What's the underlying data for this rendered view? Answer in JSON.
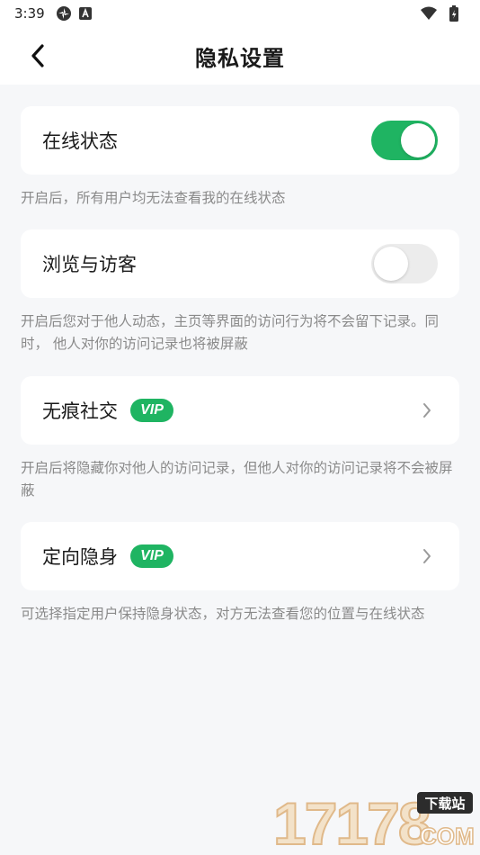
{
  "status_bar": {
    "time": "3:39",
    "icons": [
      "settings-flower-icon",
      "a-badge-icon",
      "wifi-icon",
      "battery-icon"
    ]
  },
  "header": {
    "title": "隐私设置",
    "back_icon": "chevron-left-icon"
  },
  "settings": [
    {
      "label": "在线状态",
      "control": "toggle",
      "enabled": true,
      "description": "开启后，所有用户均无法查看我的在线状态"
    },
    {
      "label": "浏览与访客",
      "control": "toggle",
      "enabled": false,
      "description": "开启后您对于他人动态，主页等界面的访问行为将不会留下记录。同时， 他人对你的访问记录也将被屏蔽"
    },
    {
      "label": "无痕社交",
      "badge": "VIP",
      "control": "chevron",
      "description": "开启后将隐藏你对他人的访问记录，但他人对你的访问记录将不会被屏蔽"
    },
    {
      "label": "定向隐身",
      "badge": "VIP",
      "control": "chevron",
      "description": "可选择指定用户保持隐身状态，对方无法查看您的位置与在线状态"
    }
  ],
  "watermark": {
    "numbers": "17178",
    "tag": "下载站",
    "suffix": "COM"
  },
  "colors": {
    "accent": "#1fb462",
    "background": "#f6f7f9",
    "card": "#ffffff",
    "desc_text": "#8a8a8a",
    "toggle_off": "#ececec"
  }
}
